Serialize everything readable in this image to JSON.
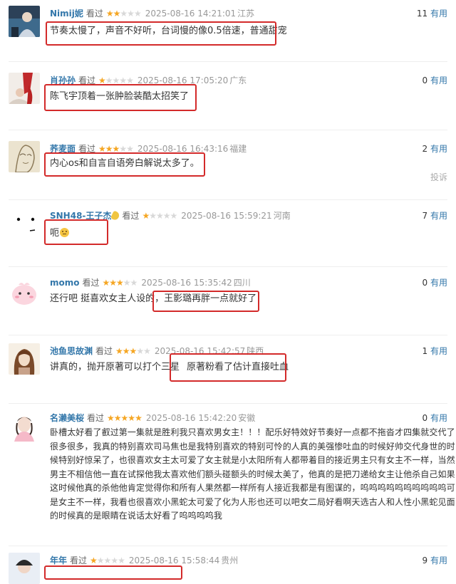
{
  "useful_label": "有用",
  "report_label": "投诉",
  "comments": [
    {
      "user": "Nimij妮",
      "seen": "看过",
      "rating": 2,
      "time": "2025-08-16 14:21:01",
      "loc": "江苏",
      "useful": "11",
      "text": "节奏太慢了，声音不好听，台词慢的像0.5倍速，普通甜宠",
      "highlight": "节奏太慢了，声音不好听，台词慢的像0.5倍速，普通甜宠"
    },
    {
      "user": "肖孙孙",
      "seen": "看过",
      "rating": 1,
      "time": "2025-08-16 17:05:20",
      "loc": "广东",
      "useful": "0",
      "text": "陈飞宇顶着一张肿脸装酷太招笑了",
      "highlight": "陈飞宇顶着一张肿脸装酷太招笑了"
    },
    {
      "user": "荞麦面",
      "seen": "看过",
      "rating": 3,
      "time": "2025-08-16 16:43:16",
      "loc": "福建",
      "useful": "2",
      "text": "内心os和自言自语旁白解说太多了。",
      "highlight": "内心os和自言自语旁白解说太多了。"
    },
    {
      "user": "SNH48-王子杰",
      "seen": "看过",
      "rating": 1,
      "time": "2025-08-16 15:59:21",
      "loc": "河南",
      "useful": "7",
      "text": "呃",
      "highlight": "呃"
    },
    {
      "user": "momo",
      "seen": "看过",
      "rating": 3,
      "time": "2025-08-16 15:35:42",
      "loc": "四川",
      "useful": "0",
      "text_pre": "还行吧 挺喜欢女主人设的，",
      "highlight": "王影璐再胖一点就好了"
    },
    {
      "user": "池鱼思故渊",
      "seen": "看过",
      "rating": 3,
      "time": "2025-08-16 15:42:57",
      "loc": "陕西",
      "useful": "1",
      "text_pre": "讲真的，抛开原著可以打个三星",
      "highlight": "原著粉看了估计直接吐血"
    },
    {
      "user": "名濑美桜",
      "seen": "看过",
      "rating": 5,
      "time": "2025-08-16 15:42:20",
      "loc": "安徽",
      "useful": "0",
      "text_lines": [
        "卧槽太好看了叡过第一集就是胜利我只喜欢男女主！！！配乐好特效好节奏好一点都不拖沓才四集就交代了",
        "很多很多，我真的特别喜欢司马焦也是我特别喜欢的特别可怜的人真的美强惨吐血的时候好帅交代身世的时",
        "候特别好惊呆了，也很喜欢女主太可爱了女主就是小太阳所有人都带着目的接近男主只有女主不一样，当然",
        "男主不相信他一直在试探他我太喜欢他们额头碰额头的时候太美了，他真的是把刀递给女主让他杀自己如果",
        "这时候他真的杀他他肯定觉得你和所有人果然都一样所有人接近我都是有图谋的，呜呜呜呜呜呜呜呜呜呜可",
        "是女主不一样，我看也很喜欢小黑蛇太可爱了化为人形也还可以吧女二局好看啊天选古人和人性小黑蛇见面",
        "的时候真的是眼睛在说话太好看了呜呜呜呜我"
      ]
    },
    {
      "user": "年年",
      "seen": "看过",
      "rating": 1,
      "time": "2025-08-16 15:58:44",
      "loc": "贵州",
      "useful": "9"
    }
  ]
}
